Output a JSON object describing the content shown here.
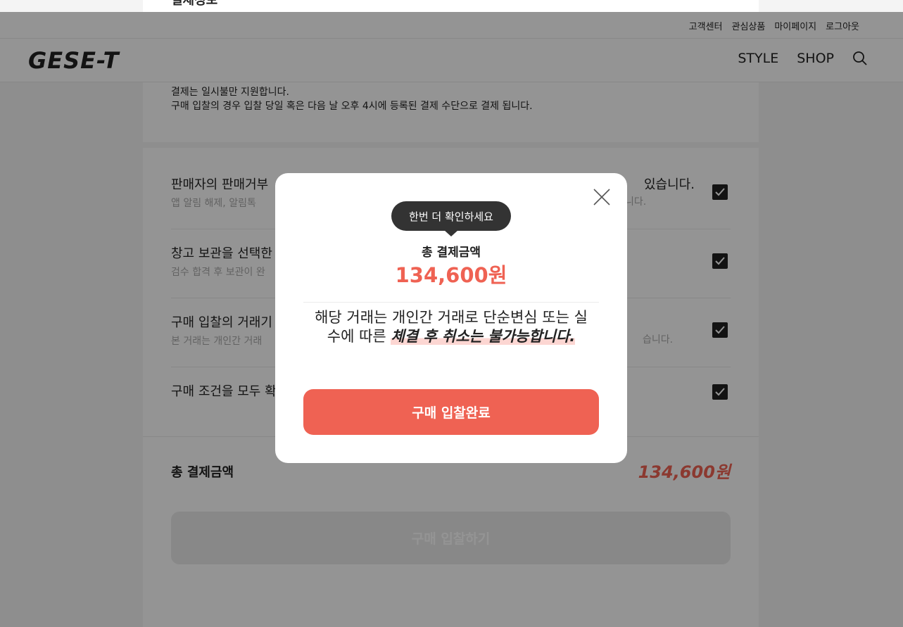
{
  "page_header_cut": "결제정보",
  "util_links": [
    "고객센터",
    "관심상품",
    "마이페이지",
    "로그아웃"
  ],
  "logo": "GESE-T",
  "nav": {
    "style": "STYLE",
    "shop": "SHOP",
    "search_icon": "search-icon"
  },
  "notice": {
    "line1": "결제는 일시불만 지원합니다.",
    "line2": "구매 입찰의 경우 입찰 당일 혹은 다음 날 오후 4시에 등록된 결제 수단으로 결제 됩니다."
  },
  "agreements": [
    {
      "title": "판매자의 판매거부",
      "tail_title": "있습니다.",
      "sub": "앱 알림 해제, 알림톡 ",
      "tail_sub": "니다.",
      "checked": true
    },
    {
      "title": "창고 보관을 선택한",
      "sub": "검수 합격 후 보관이 완",
      "checked": true
    },
    {
      "title": "구매 입찰의 거래기",
      "sub": "본 거래는 개인간 거래",
      "tail_sub": "습니다.",
      "checked": true
    },
    {
      "title": "구매 조건을 모두 확",
      "checked": true
    }
  ],
  "total": {
    "label": "총 결제금액",
    "price": "134,600원"
  },
  "bid_button": "구매 입찰하기",
  "modal": {
    "tooltip": "한번 더 확인하세요",
    "label": "총 결제금액",
    "amount": "134,600원",
    "msg_plain": "해당 거래는 개인간 거래로 단순변심 또는 실수에 따른 ",
    "msg_emph": "체결 후 취소는 불가능합니다.",
    "confirm": "구매 입찰완료"
  },
  "colors": {
    "accent": "#ef6253",
    "dark": "#222222",
    "overlay": "rgba(0,0,0,0.42)"
  }
}
